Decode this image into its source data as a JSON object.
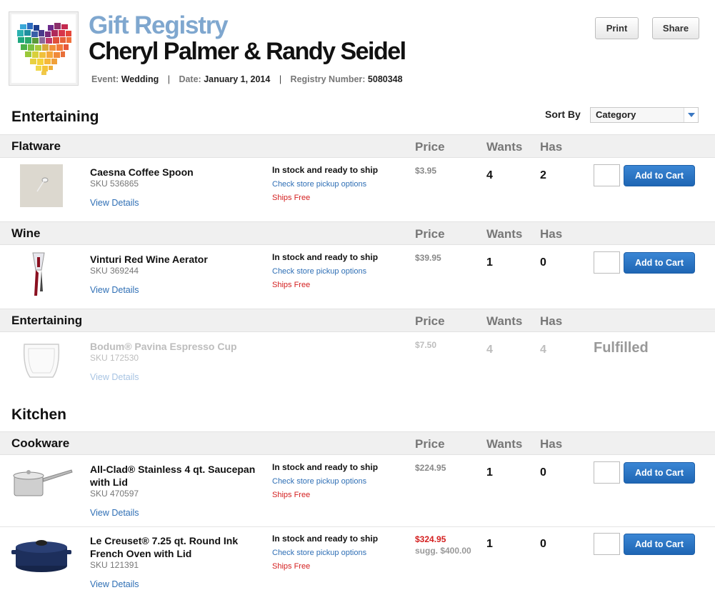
{
  "header": {
    "title": "Gift Registry",
    "names": "Cheryl Palmer & Randy Seidel",
    "event_label": "Event:",
    "event_value": "Wedding",
    "date_label": "Date:",
    "date_value": "January 1, 2014",
    "registry_label": "Registry Number:",
    "registry_value": "5080348",
    "separator": "|"
  },
  "buttons": {
    "print": "Print",
    "share": "Share"
  },
  "sort": {
    "label": "Sort By",
    "selected": "Category"
  },
  "columns": {
    "price": "Price",
    "wants": "Wants",
    "has": "Has"
  },
  "sections": [
    {
      "title": "Entertaining"
    },
    {
      "title": "Kitchen"
    }
  ],
  "categories": [
    "Flatware",
    "Wine",
    "Entertaining",
    "Cookware"
  ],
  "common": {
    "stock": "In stock and ready to ship",
    "pickup": "Check store pickup options",
    "ships_free": "Ships Free",
    "view_details": "View Details",
    "add_to_cart": "Add to Cart",
    "fulfilled": "Fulfilled"
  },
  "items": [
    {
      "name": "Caesna Coffee Spoon",
      "sku": "SKU 536865",
      "price": "$3.95",
      "wants": "4",
      "has": "2"
    },
    {
      "name": "Vinturi Red Wine Aerator",
      "sku": "SKU 369244",
      "price": "$39.95",
      "wants": "1",
      "has": "0"
    },
    {
      "name": "Bodum® Pavina Espresso Cup",
      "sku": "SKU 172530",
      "price": "$7.50",
      "wants": "4",
      "has": "4"
    },
    {
      "name": "All-Clad® Stainless 4 qt. Saucepan with Lid",
      "sku": "SKU 470597",
      "price": "$224.95",
      "wants": "1",
      "has": "0"
    },
    {
      "name": "Le Creuset® 7.25 qt. Round Ink French Oven with Lid",
      "sku": "SKU 121391",
      "price": "$324.95",
      "sugg": "sugg. $400.00",
      "wants": "1",
      "has": "0"
    }
  ],
  "colors": {
    "title_blue": "#7fa7cf",
    "link_blue": "#2f6fb5",
    "button_blue": "#1f66b4",
    "red": "#d42020"
  }
}
